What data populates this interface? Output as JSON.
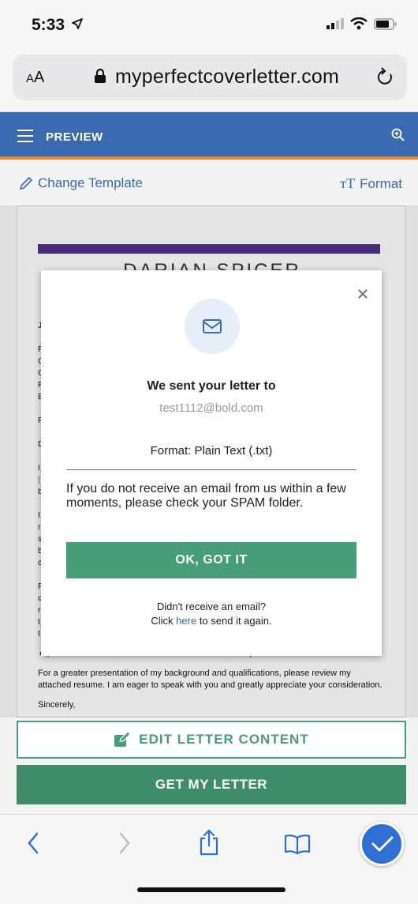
{
  "status": {
    "time": "5:33"
  },
  "browser": {
    "aa_large": "A",
    "aa_small": "A",
    "url": "myperfectcoverletter.com"
  },
  "header": {
    "title": "PREVIEW"
  },
  "toolbar": {
    "change_template": "Change Template",
    "format_glyph": "ᴛT",
    "format": "Format"
  },
  "letter": {
    "name": "DARIAN SPICER",
    "left_chars": [
      "J",
      "",
      "F",
      "C",
      "C",
      "F",
      "E",
      "",
      "F",
      "",
      "D",
      "",
      "I",
      "[",
      "b",
      "",
      "I",
      "r",
      "s",
      "b",
      "c",
      "",
      "F",
      "c",
      "r",
      "t",
      "t"
    ],
    "partial_line": "Tap 'Edit Letter Content' button to add content to the caps section.",
    "paragraph": "For a greater presentation of my background and qualifications, please review my attached resume. I am eager to speak with you and greatly appreciate your consideration.",
    "closing": "Sincerely,"
  },
  "modal": {
    "heading": "We sent your letter to",
    "email": "test1112@bold.com",
    "format": "Format: Plain Text (.txt)",
    "note": "If you do not receive an email from us within a few moments, please check your SPAM folder.",
    "ok_button": "OK, GOT IT",
    "resend_question": "Didn't receive an email?",
    "resend_prefix": "Click ",
    "resend_link": "here",
    "resend_suffix": " to send it again."
  },
  "buttons": {
    "edit": "EDIT LETTER CONTENT",
    "get": "GET MY LETTER"
  },
  "colors": {
    "brand_blue": "#3a69b0",
    "accent_orange": "#e58b33",
    "green": "#469d78",
    "purple": "#512d84"
  }
}
